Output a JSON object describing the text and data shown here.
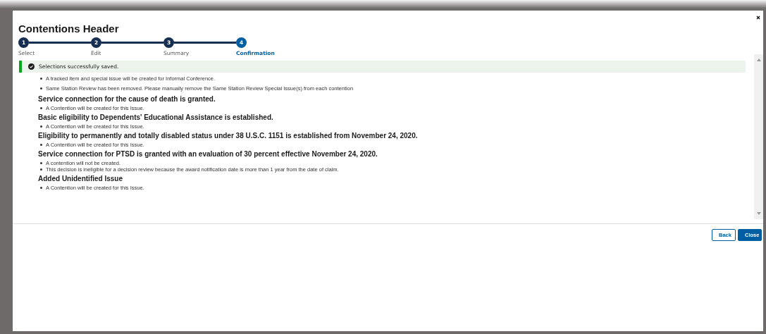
{
  "modal": {
    "title": "Contentions Header"
  },
  "steps": [
    {
      "number": "1",
      "label": "Select",
      "selected": false
    },
    {
      "number": "2",
      "label": "Edit",
      "selected": false
    },
    {
      "number": "3",
      "label": "Summary",
      "selected": false
    },
    {
      "number": "4",
      "label": "Confirmation",
      "selected": true
    }
  ],
  "alert": {
    "message": "Selections successfully saved."
  },
  "notes": [
    "A tracked item and special issue will be created for Informal Conference.",
    "Same Station Review has been removed. Please manually remove the Same Station Review Special Issue(s) from each contention"
  ],
  "issues": [
    {
      "title": "Service connection for the cause of death is granted.",
      "notes": [
        "A Contention will be created for this Issue."
      ]
    },
    {
      "title": "Basic eligibility to Dependents' Educational Assistance is established.",
      "notes": [
        "A Contention will be created for this Issue."
      ]
    },
    {
      "title": "Eligibility to permanently and totally disabled status under 38 U.S.C. 1151 is established from November 24, 2020.",
      "notes": [
        "A Contention will be created for this Issue."
      ]
    },
    {
      "title": "Service connection for PTSD is granted with an evaluation of 30 percent effective November 24, 2020.",
      "notes": [
        "A contention will not be created.",
        "This decision is ineligible for a decision review because the award notification date is more than 1 year from the date of claim."
      ]
    },
    {
      "title": "Added Unidentified Issue",
      "notes": [
        "A Contention will be created for this Issue."
      ]
    }
  ],
  "buttons": [
    {
      "label": "Back",
      "kind": "secondary"
    },
    {
      "label": "Close",
      "kind": "primary"
    }
  ]
}
